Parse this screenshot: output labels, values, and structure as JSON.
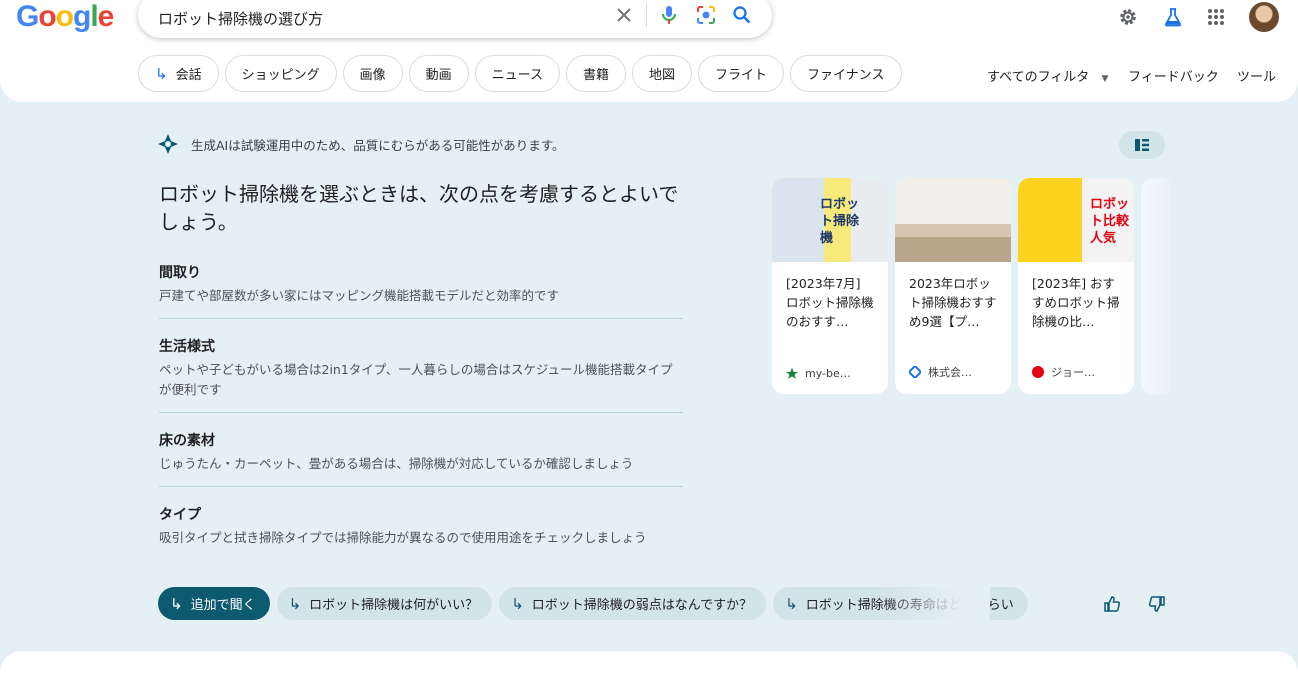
{
  "logo": {
    "letters": [
      "G",
      "o",
      "o",
      "g",
      "l",
      "e"
    ],
    "colors": [
      "#4285f4",
      "#ea4335",
      "#fbbc05",
      "#4285f4",
      "#34a853",
      "#ea4335"
    ]
  },
  "search": {
    "query": "ロボット掃除機の選び方"
  },
  "tabs": [
    {
      "label": "会話",
      "icon": "arrow-return-icon"
    },
    {
      "label": "ショッピング"
    },
    {
      "label": "画像"
    },
    {
      "label": "動画"
    },
    {
      "label": "ニュース"
    },
    {
      "label": "書籍"
    },
    {
      "label": "地図"
    },
    {
      "label": "フライト"
    },
    {
      "label": "ファイナンス"
    }
  ],
  "toolbar": {
    "all_filters": "すべてのフィルタ",
    "feedback": "フィードバック",
    "tools": "ツール"
  },
  "sge": {
    "notice": "生成AIは試験運用中のため、品質にむらがある可能性があります。",
    "title": "ロボット掃除機を選ぶときは、次の点を考慮するとよいでしょう。",
    "criteria": [
      {
        "heading": "間取り",
        "body": "戸建てや部屋数が多い家にはマッピング機能搭載モデルだと効率的です"
      },
      {
        "heading": "生活様式",
        "body": "ペットや子どもがいる場合は2in1タイプ、一人暮らしの場合はスケジュール機能搭載タイプが便利です"
      },
      {
        "heading": "床の素材",
        "body": "じゅうたん・カーペット、畳がある場合は、掃除機が対応しているか確認しましょう"
      },
      {
        "heading": "タイプ",
        "body": "吸引タイプと拭き掃除タイプでは掃除能力が異なるので使用用途をチェックしましょう"
      }
    ],
    "cards": [
      {
        "title": "[2023年7月] ロボット掃除機のおすす…",
        "source": "my-be…",
        "thumb_text": "ロボット掃除機",
        "source_icon": "green-star-icon"
      },
      {
        "title": "2023年ロボット掃除機おすすめ9選【プ…",
        "source": "株式会…",
        "source_icon": "blue-diamond-icon"
      },
      {
        "title": "[2023年] おすすめロボット掃除機の比…",
        "source": "ジョー…",
        "thumb_text": "ロボット比較 人気",
        "source_icon": "red-circle-icon"
      }
    ],
    "followups": [
      {
        "label": "追加で聞く"
      },
      {
        "label": "ロボット掃除機は何がいい？"
      },
      {
        "label": "ロボット掃除機の弱点はなんですか？"
      },
      {
        "label": "ロボット掃除機の寿命はどれくらい"
      }
    ]
  },
  "colors": {
    "accent": "#0b5a6f",
    "panel_bg": "#e5f0f4",
    "chip_bg": "#d3e3ea"
  }
}
